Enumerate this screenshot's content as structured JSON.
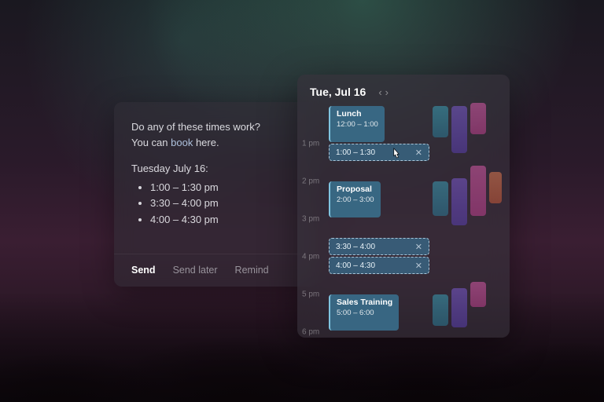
{
  "message": {
    "line1": "Do any of these times work?",
    "line2_pre": "You can ",
    "book_link": "book",
    "line2_post": " here.",
    "date_line": "Tuesday July 16:",
    "times": [
      "1:00 – 1:30 pm",
      "3:30 – 4:00 pm",
      "4:00 – 4:30 pm"
    ],
    "actions": {
      "send": "Send",
      "send_later": "Send later",
      "remind": "Remind"
    }
  },
  "calendar": {
    "title": "Tue, Jul 16",
    "hours": [
      "1 pm",
      "2 pm",
      "3 pm",
      "4 pm",
      "5 pm",
      "6 pm"
    ],
    "events": {
      "lunch": {
        "title": "Lunch",
        "time": "12:00 – 1:00"
      },
      "proposal": {
        "title": "Proposal",
        "time": "2:00 – 3:00"
      },
      "sales": {
        "title": "Sales Training",
        "time": "5:00 – 6:00"
      }
    },
    "slots": {
      "s1": "1:00 – 1:30",
      "s2": "3:30 – 4:00",
      "s3": "4:00 – 4:30"
    },
    "close_glyph": "✕"
  }
}
